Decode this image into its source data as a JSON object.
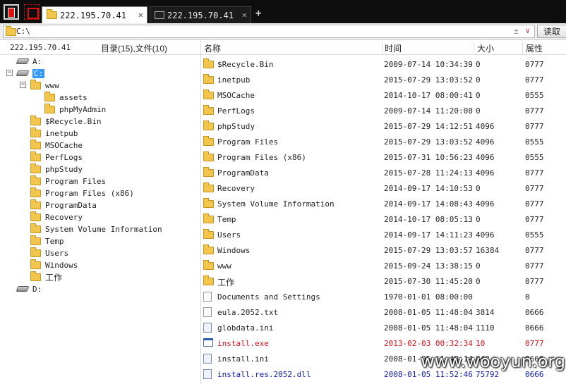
{
  "tabs": [
    {
      "label": "222.195.70.41",
      "icon": "folder-icon",
      "active": true,
      "close": "✕"
    },
    {
      "label": "222.195.70.41",
      "icon": "terminal-icon",
      "active": false,
      "close": "✕"
    }
  ],
  "new_tab": "+",
  "address": {
    "value": "C:\\",
    "pm_symbol": "±",
    "dropdown": "∨",
    "read_button": "读取"
  },
  "info": {
    "host": "222.195.70.41",
    "counts": "目录(15),文件(10)"
  },
  "tree": {
    "drives": [
      "A:",
      "C:",
      "D:"
    ],
    "www_children": [
      "assets",
      "phpMyAdmin"
    ],
    "c_children": [
      "www",
      "$Recycle.Bin",
      "inetpub",
      "MSOCache",
      "PerfLogs",
      "phpStudy",
      "Program Files",
      "Program Files (x86)",
      "ProgramData",
      "Recovery",
      "System Volume Information",
      "Temp",
      "Users",
      "Windows",
      "工作"
    ],
    "expand_minus": "−"
  },
  "columns": {
    "name": "名称",
    "time": "时间",
    "size": "大小",
    "attr": "属性"
  },
  "files": [
    {
      "type": "folder",
      "name": "$Recycle.Bin",
      "time": "2009-07-14 10:34:39",
      "size": "0",
      "attr": "0777"
    },
    {
      "type": "folder",
      "name": "inetpub",
      "time": "2015-07-29 13:03:52",
      "size": "0",
      "attr": "0777"
    },
    {
      "type": "folder",
      "name": "MSOCache",
      "time": "2014-10-17 08:00:41",
      "size": "0",
      "attr": "0555"
    },
    {
      "type": "folder",
      "name": "PerfLogs",
      "time": "2009-07-14 11:20:08",
      "size": "0",
      "attr": "0777"
    },
    {
      "type": "folder",
      "name": "phpStudy",
      "time": "2015-07-29 14:12:51",
      "size": "4096",
      "attr": "0777"
    },
    {
      "type": "folder",
      "name": "Program Files",
      "time": "2015-07-29 13:03:52",
      "size": "4096",
      "attr": "0555"
    },
    {
      "type": "folder",
      "name": "Program Files (x86)",
      "time": "2015-07-31 10:56:23",
      "size": "4096",
      "attr": "0555"
    },
    {
      "type": "folder",
      "name": "ProgramData",
      "time": "2015-07-28 11:24:13",
      "size": "4096",
      "attr": "0777"
    },
    {
      "type": "folder",
      "name": "Recovery",
      "time": "2014-09-17 14:10:53",
      "size": "0",
      "attr": "0777"
    },
    {
      "type": "folder",
      "name": "System Volume Information",
      "time": "2014-09-17 14:08:43",
      "size": "4096",
      "attr": "0777"
    },
    {
      "type": "folder",
      "name": "Temp",
      "time": "2014-10-17 08:05:13",
      "size": "0",
      "attr": "0777"
    },
    {
      "type": "folder",
      "name": "Users",
      "time": "2014-09-17 14:11:23",
      "size": "4096",
      "attr": "0555"
    },
    {
      "type": "folder",
      "name": "Windows",
      "time": "2015-07-29 13:03:57",
      "size": "16384",
      "attr": "0777"
    },
    {
      "type": "folder",
      "name": "www",
      "time": "2015-09-24 13:38:15",
      "size": "0",
      "attr": "0777"
    },
    {
      "type": "folder",
      "name": "工作",
      "time": "2015-07-30 11:45:20",
      "size": "0",
      "attr": "0777"
    },
    {
      "type": "file",
      "name": "Documents and Settings",
      "time": "1970-01-01 08:00:00",
      "size": "",
      "attr": "0"
    },
    {
      "type": "file",
      "name": "eula.2052.txt",
      "time": "2008-01-05 11:48:04",
      "size": "3814",
      "attr": "0666"
    },
    {
      "type": "ini",
      "name": "globdata.ini",
      "time": "2008-01-05 11:48:04",
      "size": "1110",
      "attr": "0666"
    },
    {
      "type": "exe",
      "name": "install.exe",
      "time": "2013-02-03 00:32:34",
      "size": "10",
      "attr": "0777",
      "color": "red"
    },
    {
      "type": "ini",
      "name": "install.ini",
      "time": "2008-01-05 11:48:14",
      "size": "843",
      "attr": "0666"
    },
    {
      "type": "ini",
      "name": "install.res.2052.dll",
      "time": "2008-01-05 11:52:46",
      "size": "75792",
      "attr": "0666",
      "color": "blue"
    }
  ],
  "watermark": "www.wooyun.org"
}
